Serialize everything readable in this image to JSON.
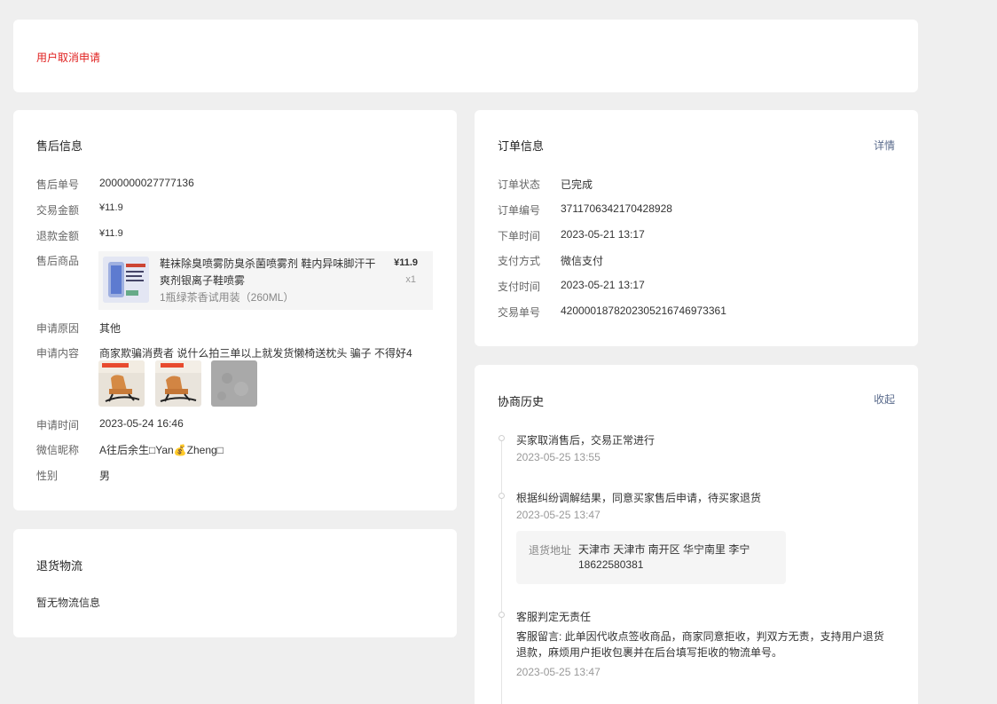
{
  "status": {
    "text": "用户取消申请"
  },
  "aftersale": {
    "title": "售后信息",
    "rows": [
      {
        "label": "售后单号",
        "value": "2000000027777136"
      },
      {
        "label": "交易金额",
        "value": "¥11.9"
      },
      {
        "label": "退款金额",
        "value": "¥11.9"
      },
      {
        "label": "售后商品"
      },
      {
        "label": "申请原因",
        "value": "其他"
      },
      {
        "label": "申请内容",
        "value": "商家欺骗消费者 说什么拍三单以上就发货懒椅送枕头 骗子 不得好4"
      },
      {
        "label": "申请时间",
        "value": "2023-05-24 16:46"
      },
      {
        "label": "微信昵称",
        "value": "A往后余生□Yan💰Zheng□"
      },
      {
        "label": "性别",
        "value": "男"
      }
    ],
    "goods": {
      "name": "鞋袜除臭喷雾防臭杀菌喷雾剂 鞋内异味脚汗干爽剂银离子鞋喷雾",
      "spec": "1瓶绿茶香试用装（260ML）",
      "price": "¥11.9",
      "qty": "x1",
      "thumb_text": "3713 除臭喷雾"
    }
  },
  "logistics": {
    "title": "退货物流",
    "empty": "暂无物流信息"
  },
  "order": {
    "title": "订单信息",
    "detail_link": "详情",
    "rows": [
      {
        "label": "订单状态",
        "value": "已完成"
      },
      {
        "label": "订单编号",
        "value": "3711706342170428928"
      },
      {
        "label": "下单时间",
        "value": "2023-05-21 13:17"
      },
      {
        "label": "支付方式",
        "value": "微信支付"
      },
      {
        "label": "支付时间",
        "value": "2023-05-21 13:17"
      },
      {
        "label": "交易单号",
        "value": "4200001878202305216746973361"
      }
    ]
  },
  "history": {
    "title": "协商历史",
    "collapse_link": "收起",
    "items": [
      {
        "title": "买家取消售后，交易正常进行",
        "time": "2023-05-25 13:55"
      },
      {
        "title": "根据纠纷调解结果，同意买家售后申请，待买家退货",
        "time": "2023-05-25 13:47",
        "address_label": "退货地址",
        "address": "天津市 天津市 南开区 华宁南里 李宁 18622580381"
      },
      {
        "title": "客服判定无责任",
        "note": "客服留言: 此单因代收点签收商品，商家同意拒收，判双方无责，支持用户退货退款，麻烦用户拒收包裹并在后台填写拒收的物流单号。",
        "time": "2023-05-25 13:47"
      }
    ]
  }
}
